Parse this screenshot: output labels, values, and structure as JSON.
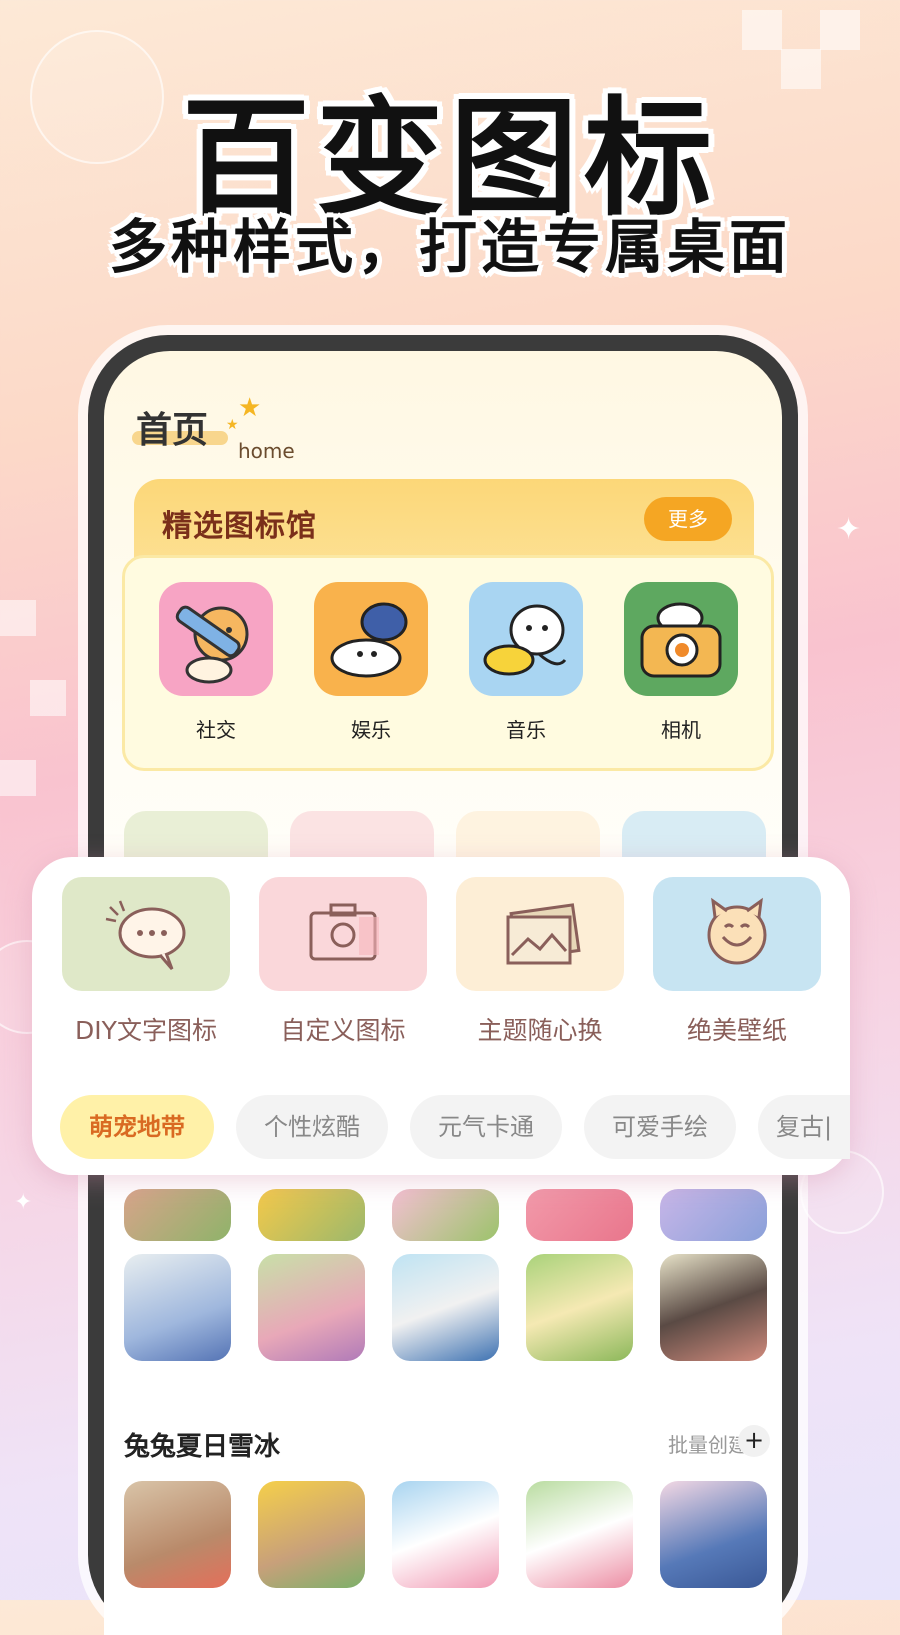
{
  "banner": {
    "headline": "百变图标",
    "subline": "多种样式，打造专属桌面"
  },
  "home": {
    "title": "首页",
    "subtitle": "home"
  },
  "featured": {
    "title": "精选图标馆",
    "more_label": "更多",
    "apps": [
      {
        "label": "社交",
        "icon": "tiger-pencil-icon",
        "color": "#f7a4c4"
      },
      {
        "label": "娱乐",
        "icon": "bunny-dog-icon",
        "color": "#f9b24c"
      },
      {
        "label": "音乐",
        "icon": "dog-duck-icon",
        "color": "#a9d5f2"
      },
      {
        "label": "相机",
        "icon": "camera-bear-icon",
        "color": "#5ea860"
      }
    ]
  },
  "features": [
    {
      "label": "DIY文字图标",
      "icon": "chat-bubble-icon",
      "color": "#dfe8c8"
    },
    {
      "label": "自定义图标",
      "icon": "camera-icon",
      "color": "#fad7da"
    },
    {
      "label": "主题随心换",
      "icon": "picture-icon",
      "color": "#fdeed6"
    },
    {
      "label": "绝美壁纸",
      "icon": "smiley-cat-icon",
      "color": "#c7e4f2"
    }
  ],
  "categories": [
    "萌宠地带",
    "个性炫酷",
    "元气卡通",
    "可爱手绘",
    "复古|"
  ],
  "section": {
    "title": "兔兔夏日雪冰",
    "batch_label": "批量创建",
    "plus_label": "+"
  }
}
